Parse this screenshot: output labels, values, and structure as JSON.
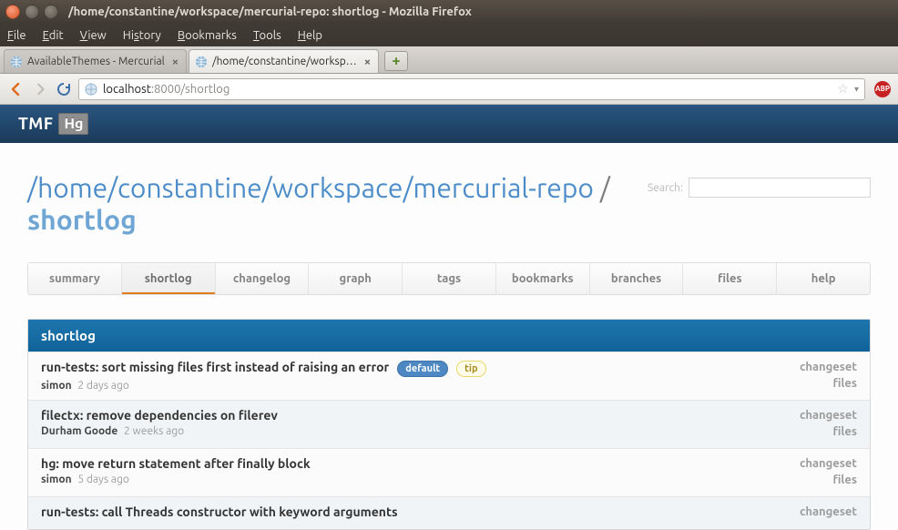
{
  "window": {
    "title": "/home/constantine/workspace/mercurial-repo: shortlog - Mozilla Firefox"
  },
  "menubar": [
    "File",
    "Edit",
    "View",
    "History",
    "Bookmarks",
    "Tools",
    "Help"
  ],
  "tabs": [
    {
      "label": "AvailableThemes - Mercurial",
      "active": false
    },
    {
      "label": "/home/constantine/worksp…",
      "active": true
    }
  ],
  "url": {
    "host": "localhost",
    "port": ":8000",
    "path": "/shortlog"
  },
  "banner": {
    "brand": "TMF",
    "box": "Hg"
  },
  "heading": {
    "repo": "/home/constantine/workspace/mercurial-repo",
    "slash": " / ",
    "sub": "shortlog"
  },
  "search": {
    "label": "Search:",
    "value": ""
  },
  "navtabs": [
    "summary",
    "shortlog",
    "changelog",
    "graph",
    "tags",
    "bookmarks",
    "branches",
    "files",
    "help"
  ],
  "navactive": 1,
  "panel": {
    "title": "shortlog"
  },
  "badges": {
    "default": "default",
    "tip": "tip"
  },
  "linklabels": {
    "changeset": "changeset",
    "files": "files"
  },
  "entries": [
    {
      "title": "run-tests: sort missing files first instead of raising an error",
      "author": "simon",
      "ago": "2 days ago",
      "badges": [
        "default",
        "tip"
      ]
    },
    {
      "title": "filectx: remove dependencies on filerev",
      "author": "Durham Goode",
      "ago": "2 weeks ago",
      "badges": []
    },
    {
      "title": "hg: move return statement after finally block",
      "author": "simon",
      "ago": "5 days ago",
      "badges": []
    },
    {
      "title": "run-tests: call Threads constructor with keyword arguments",
      "author": "",
      "ago": "",
      "badges": []
    }
  ]
}
